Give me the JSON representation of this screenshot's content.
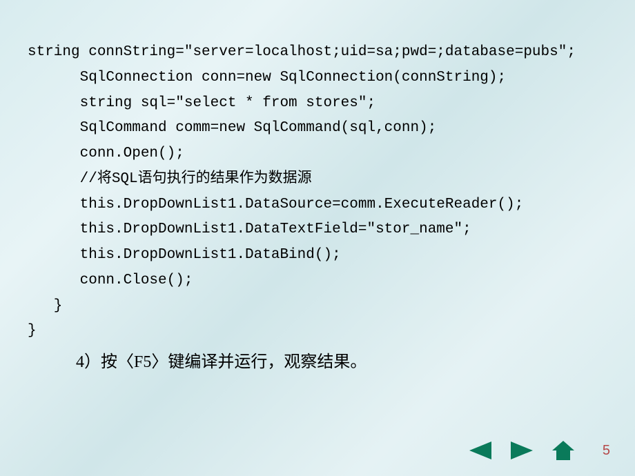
{
  "code": {
    "line1": "string connString=\"server=localhost;uid=sa;pwd=;database=pubs\";",
    "line2": "      SqlConnection conn=new SqlConnection(connString);",
    "line3": "      string sql=\"select * from stores\";",
    "line4": "      SqlCommand comm=new SqlCommand(sql,conn);",
    "line5": "      conn.Open();",
    "line6": "      //将SQL语句执行的结果作为数据源",
    "line7": "      this.DropDownList1.DataSource=comm.ExecuteReader();",
    "line8": "      this.DropDownList1.DataTextField=\"stor_name\";",
    "line9": "      this.DropDownList1.DataBind();",
    "line10": "      conn.Close();",
    "line11": "   }",
    "line12": "}"
  },
  "instruction": "4）按〈F5〉键编译并运行，观察结果。",
  "pageNumber": "5"
}
